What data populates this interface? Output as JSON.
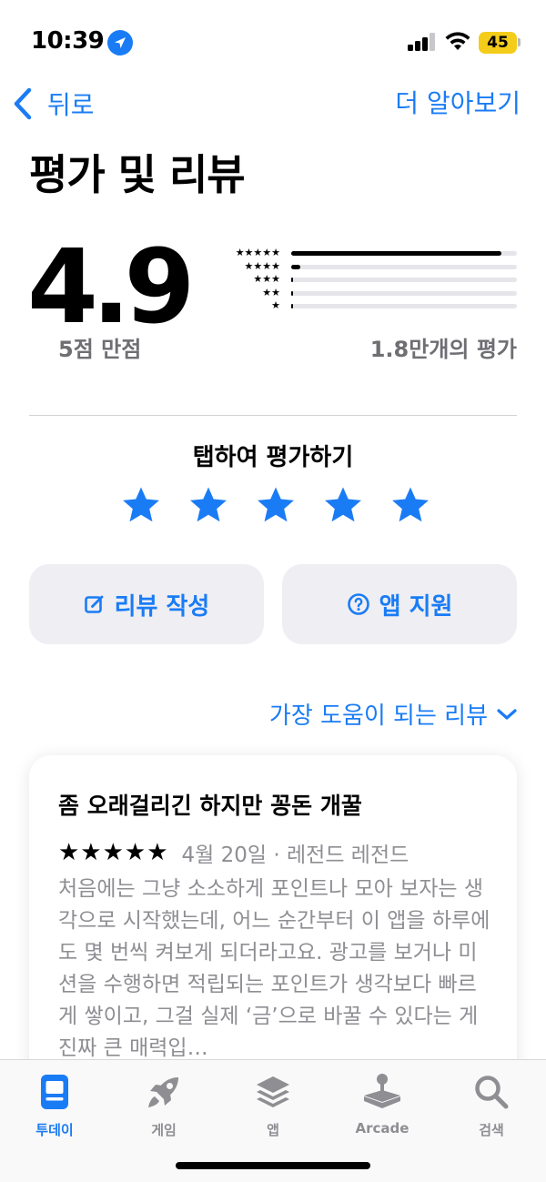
{
  "status_bar": {
    "time": "10:39",
    "battery": "45"
  },
  "nav": {
    "back_label": "뒤로",
    "learn_more": "더 알아보기"
  },
  "page_title": "평가 및 리뷰",
  "summary": {
    "score": "4.9",
    "out_of": "5점 만점",
    "rating_count": "1.8만개의 평가",
    "histogram": [
      {
        "stars": "★★★★★",
        "fraction": 0.93
      },
      {
        "stars": "★★★★",
        "fraction": 0.04
      },
      {
        "stars": "★★★",
        "fraction": 0.01
      },
      {
        "stars": "★★",
        "fraction": 0.005
      },
      {
        "stars": "★",
        "fraction": 0.01
      }
    ]
  },
  "tap_to_rate": {
    "label": "탭하여 평가하기"
  },
  "actions": {
    "write_review": "리뷰 작성",
    "app_support": "앱 지원"
  },
  "sort": {
    "label": "가장 도움이 되는 리뷰"
  },
  "review": {
    "title": "좀 오래걸리긴 하지만 꽁돈 개꿀",
    "stars": "★★★★★",
    "date_author": "4월 20일 · 레전드 레전드",
    "body": "처음에는 그냥 소소하게 포인트나 모아 보자는 생각으로 시작했는데, 어느 순간부터 이 앱을 하루에도 몇 번씩 켜보게 되더라고요. 광고를 보거나 미션을 수행하면 적립되는 포인트가 생각보다 빠르게 쌓이고, 그걸 실제 ‘금’으로 바꿀 수 있다는 게 진짜 큰 매력입…"
  },
  "tab_bar": {
    "tabs": [
      {
        "label": "투데이",
        "icon": "today-icon",
        "active": true
      },
      {
        "label": "게임",
        "icon": "rocket-icon",
        "active": false
      },
      {
        "label": "앱",
        "icon": "layers-icon",
        "active": false
      },
      {
        "label": "Arcade",
        "icon": "joystick-icon",
        "active": false
      },
      {
        "label": "검색",
        "icon": "search-icon",
        "active": false
      }
    ]
  },
  "colors": {
    "accent": "#1a7cf5",
    "battery": "#f4cc1a",
    "secondary_text": "#8e8e93"
  }
}
